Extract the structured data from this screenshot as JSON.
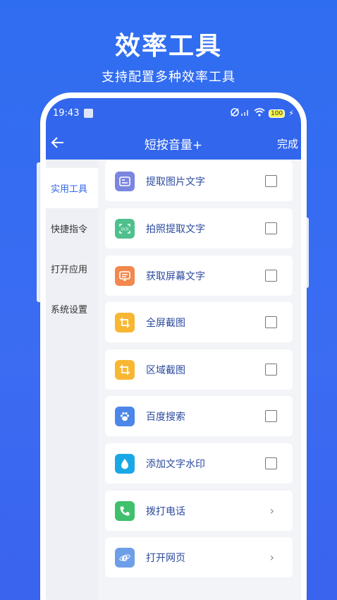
{
  "promo": {
    "headline": "效率工具",
    "subline": "支持配置多种效率工具"
  },
  "status_bar": {
    "time": "19:43",
    "battery": "100"
  },
  "nav": {
    "title": "短按音量+",
    "done_label": "完成"
  },
  "sidebar": {
    "items": [
      {
        "label": "实用工具",
        "active": true
      },
      {
        "label": "快捷指令",
        "active": false
      },
      {
        "label": "打开应用",
        "active": false
      },
      {
        "label": "系统设置",
        "active": false
      }
    ]
  },
  "tools": [
    {
      "label": "提取图片文字",
      "icon": "image-text-icon",
      "color": "#7b86e0",
      "control": "checkbox"
    },
    {
      "label": "拍照提取文字",
      "icon": "ocr-camera-icon",
      "color": "#4fc08d",
      "control": "checkbox"
    },
    {
      "label": "获取屏幕文字",
      "icon": "screen-text-icon",
      "color": "#f2884d",
      "control": "checkbox"
    },
    {
      "label": "全屏截图",
      "icon": "crop-icon",
      "color": "#f7b733",
      "control": "checkbox"
    },
    {
      "label": "区域截图",
      "icon": "crop-area-icon",
      "color": "#f7b733",
      "control": "checkbox"
    },
    {
      "label": "百度搜索",
      "icon": "paw-icon",
      "color": "#4c86e8",
      "control": "checkbox"
    },
    {
      "label": "添加文字水印",
      "icon": "drop-icon",
      "color": "#1aa7e6",
      "control": "checkbox"
    },
    {
      "label": "拨打电话",
      "icon": "phone-icon",
      "color": "#3fc06d",
      "control": "chevron"
    },
    {
      "label": "打开网页",
      "icon": "browser-icon",
      "color": "#6d9ee8",
      "control": "chevron"
    }
  ]
}
